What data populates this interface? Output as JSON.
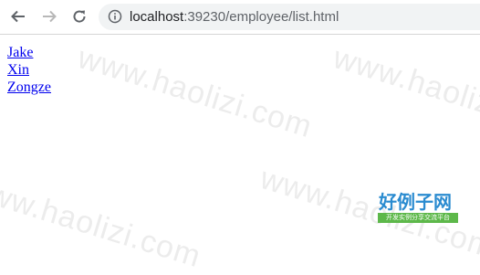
{
  "browser": {
    "address_host": "localhost",
    "address_rest": ":39230/employee/list.html",
    "icons": {
      "back": "arrow-left",
      "forward": "arrow-right",
      "reload": "reload",
      "info": "info-circle"
    }
  },
  "page": {
    "employees": [
      "Jake",
      "Xin",
      "Zongze"
    ]
  },
  "watermark": {
    "text": "www.haolizi.com",
    "logo_main": "好例子网",
    "logo_sub": "开发实例分享交流平台"
  },
  "colors": {
    "link": "#0000ee",
    "toolbar_bg": "#ffffff",
    "omnibox_bg": "#f1f3f4",
    "logo_blue": "#2a8bd0",
    "logo_green": "#5db84a"
  }
}
